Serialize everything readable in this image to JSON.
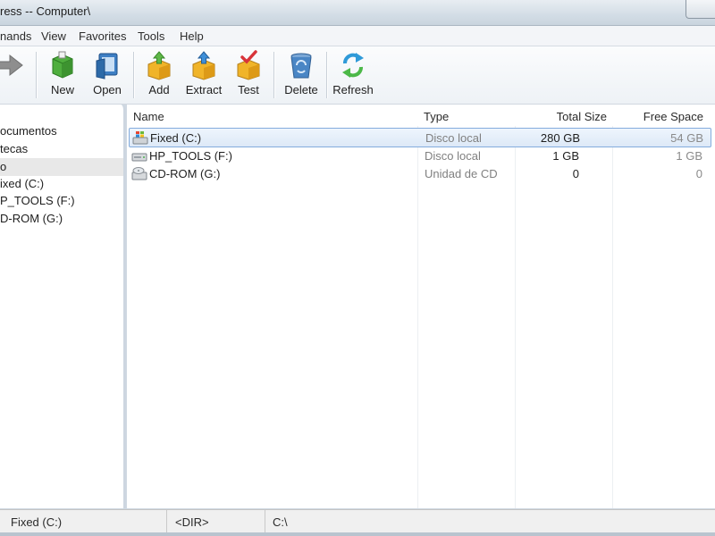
{
  "window": {
    "title": "ress -- Computer\\"
  },
  "menu": [
    "nands",
    "View",
    "Favorites",
    "Tools",
    "Help"
  ],
  "toolbar": {
    "buttons": [
      {
        "label": "New"
      },
      {
        "label": "Open"
      },
      {
        "label": "Add"
      },
      {
        "label": "Extract"
      },
      {
        "label": "Test"
      },
      {
        "label": "Delete"
      },
      {
        "label": "Refresh"
      }
    ]
  },
  "tree": {
    "items": [
      "ocumentos",
      "tecas",
      "o",
      "ixed (C:)",
      "P_TOOLS (F:)",
      "D-ROM (G:)"
    ],
    "selected_index": 2
  },
  "list": {
    "columns": [
      "Name",
      "Type",
      "Total Size",
      "Free Space"
    ],
    "rows": [
      {
        "name": "Fixed (C:)",
        "type": "Disco local",
        "total": "280 GB",
        "free": "54 GB",
        "icon": "hard-drive-windows-icon"
      },
      {
        "name": "HP_TOOLS (F:)",
        "type": "Disco local",
        "total": "1 GB",
        "free": "1 GB",
        "icon": "hard-drive-icon"
      },
      {
        "name": "CD-ROM (G:)",
        "type": "Unidad de CD",
        "total": "0",
        "free": "0",
        "icon": "cd-drive-icon"
      }
    ],
    "selected_index": 0
  },
  "status": {
    "name": "Fixed (C:)",
    "kind": "<DIR>",
    "path": "C:\\"
  },
  "colors": {
    "selection_border": "#84acdd",
    "selection_fill": "#dde9f7",
    "muted_text": "#808080"
  }
}
